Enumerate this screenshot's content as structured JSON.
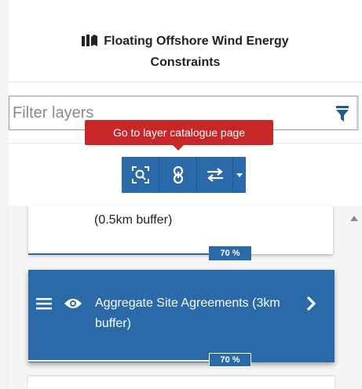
{
  "header": {
    "title_line1": "Floating Offshore Wind Energy",
    "title_line2": "Constraints",
    "icon": "map-book-icon"
  },
  "filter": {
    "placeholder": "Filter layers",
    "icon": "funnel-filter-icon"
  },
  "tooltip": {
    "text": "Go to layer catalogue page"
  },
  "toolbar": {
    "buttons": [
      "zoom-to-layer-icon",
      "link-icon",
      "swap-arrows-icon",
      "caret-down-icon"
    ]
  },
  "layers": [
    {
      "title": "(0.5km buffer)",
      "opacity": "70 %",
      "opacity_value": 70,
      "selected": false
    },
    {
      "title": "Aggregate Site Agreements (3km buffer)",
      "opacity": "70 %",
      "opacity_value": 70,
      "selected": true
    }
  ],
  "colors": {
    "accent": "#2a6aa8",
    "tooltip": "#c62828"
  }
}
